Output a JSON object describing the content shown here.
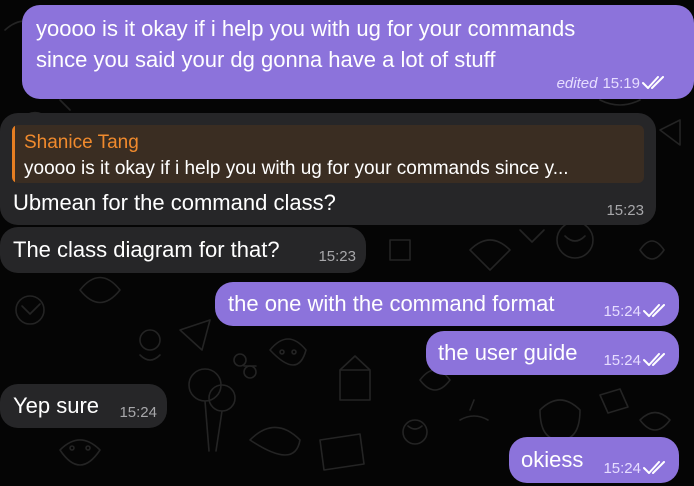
{
  "messages": [
    {
      "lines": [
        "yoooo is it okay if i help you with ug for your commands",
        "since you said your dg gonna have a lot of stuff"
      ],
      "edited": "edited",
      "time": "15:19"
    },
    {
      "reply": {
        "author": "Shanice Tang",
        "text": "yoooo is it okay if i help you with ug for your commands since y..."
      },
      "text": "Ubmean for the command class?",
      "time": "15:23"
    },
    {
      "text": "The class diagram for that?",
      "time": "15:23"
    },
    {
      "text": "the one with the command format",
      "time": "15:24"
    },
    {
      "text": "the user guide",
      "time": "15:24"
    },
    {
      "text": "Yep sure",
      "time": "15:24"
    },
    {
      "text": "okiess",
      "time": "15:24"
    }
  ],
  "colors": {
    "outgoing_bubble": "#8c73db",
    "incoming_bubble": "#262628",
    "reply_accent": "#e67e22",
    "background": "#050505"
  },
  "icons": [
    "read-checkmarks-icon",
    "chat-doodle-pattern"
  ]
}
